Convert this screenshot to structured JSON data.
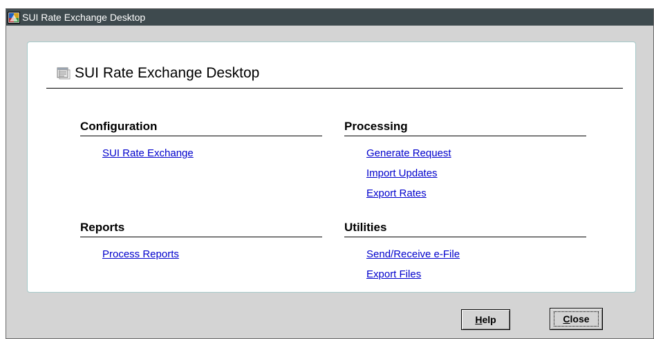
{
  "window": {
    "title": "SUI Rate Exchange Desktop"
  },
  "header": {
    "title": "SUI Rate Exchange Desktop"
  },
  "sections": {
    "configuration": {
      "title": "Configuration",
      "links": [
        "SUI Rate Exchange"
      ]
    },
    "processing": {
      "title": "Processing",
      "links": [
        "Generate Request",
        "Import Updates",
        "Export Rates"
      ]
    },
    "reports": {
      "title": "Reports",
      "links": [
        "Process Reports"
      ]
    },
    "utilities": {
      "title": "Utilities",
      "links": [
        "Send/Receive e-File",
        "Export Files"
      ]
    }
  },
  "buttons": {
    "help": {
      "mnemonic": "H",
      "rest": "elp"
    },
    "close": {
      "mnemonic": "C",
      "rest": "lose"
    }
  },
  "colors": {
    "titlebar": "#3e4a4e",
    "link": "#0000cc",
    "window_bg": "#d4d4d4",
    "panel_border": "#a6c9c9"
  },
  "icons": {
    "titlebar": "app-window-icon",
    "header": "desktop-document-icon"
  }
}
